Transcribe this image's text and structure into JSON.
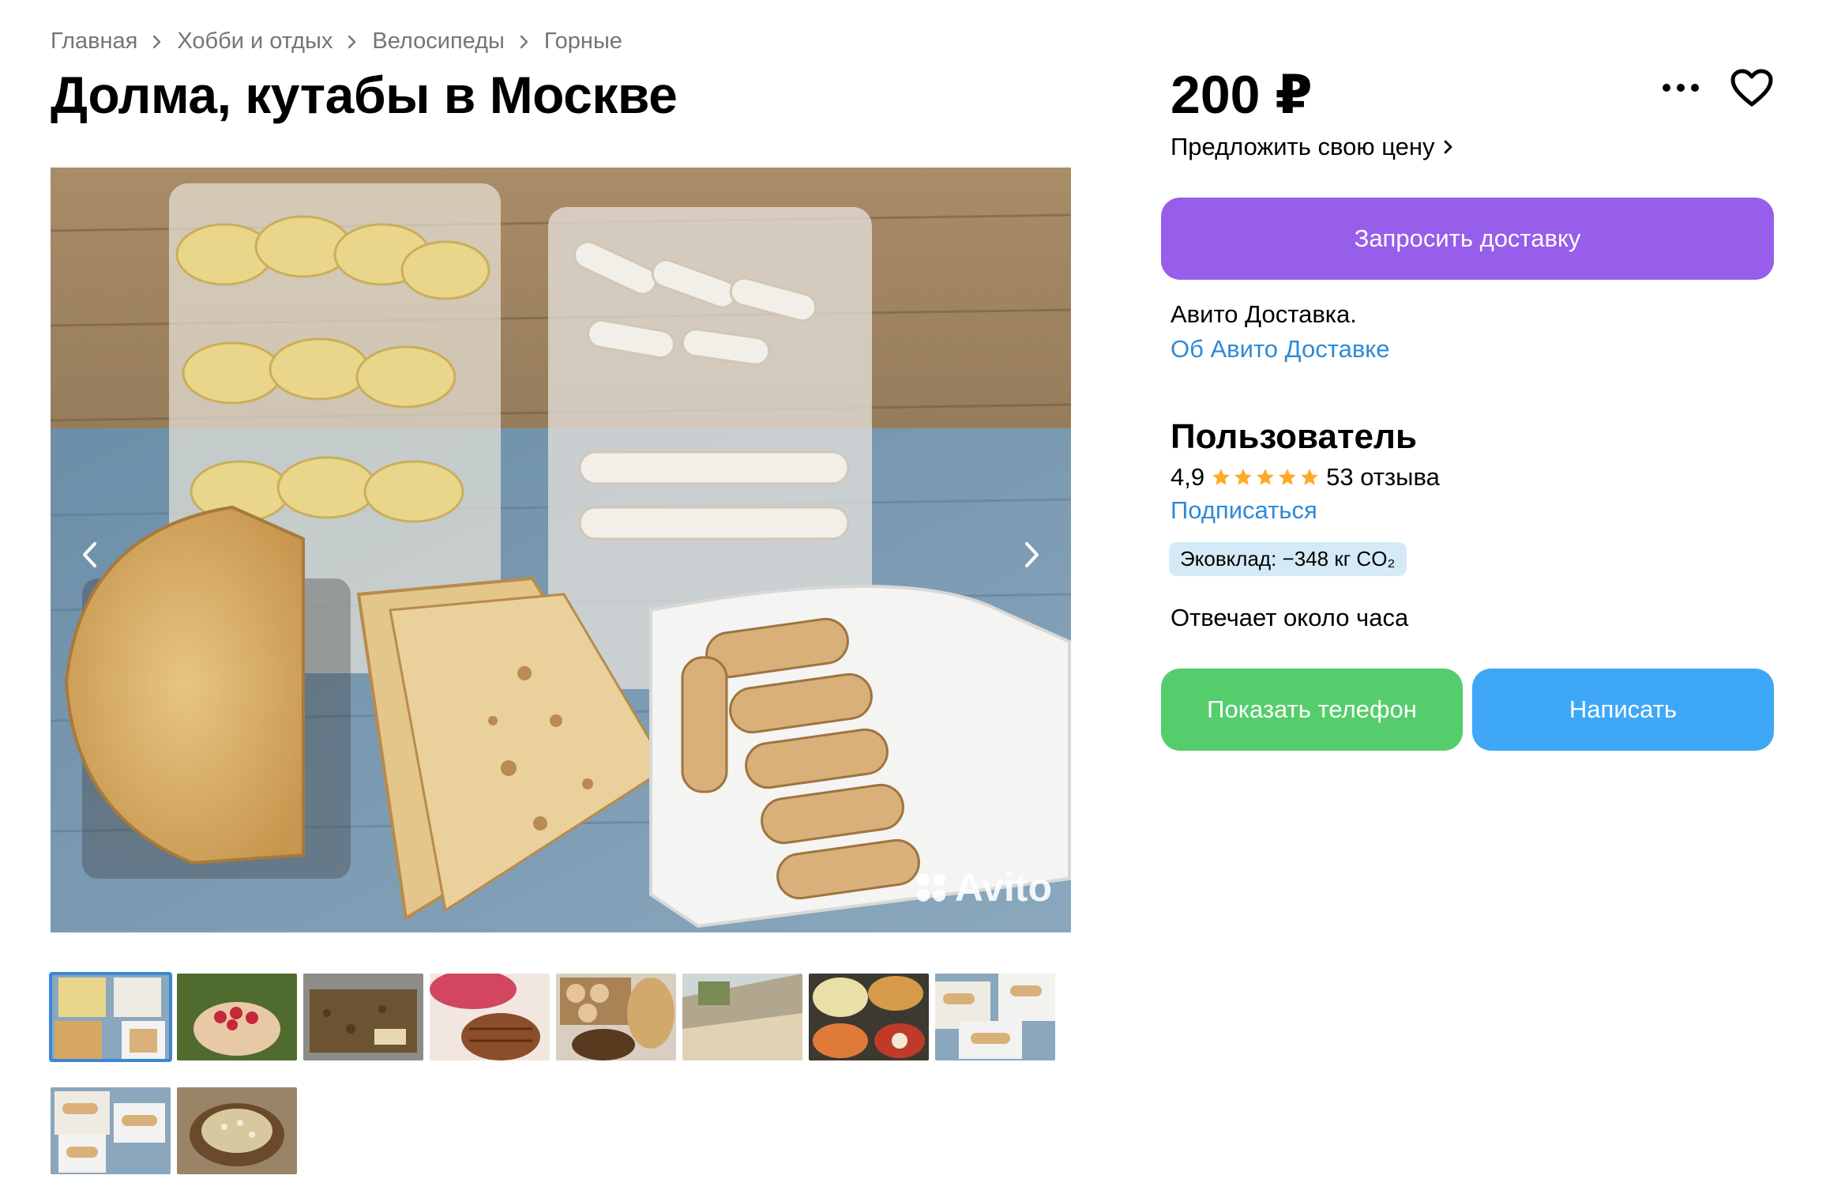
{
  "breadcrumbs": [
    "Главная",
    "Хобби и отдых",
    "Велосипеды",
    "Горные"
  ],
  "title": "Долма, кутабы в Москве",
  "gallery": {
    "watermark": "Avito",
    "prev_icon": "chevron-left-icon",
    "next_icon": "chevron-right-icon",
    "thumbnail_count": 10,
    "active_thumbnail": 1
  },
  "price": "200 ₽",
  "offer_price": "Предложить свою цену",
  "buttons": {
    "delivery": "Запросить доставку",
    "phone": "Показать телефон",
    "write": "Написать"
  },
  "delivery": {
    "text": "Авито Доставка.",
    "link": "Об Авито Доставке"
  },
  "seller": {
    "name": "Пользователь",
    "rating": "4,9",
    "stars": 5,
    "reviews": "53 отзыва",
    "subscribe": "Подписаться",
    "eco": "Эковклад: −348 кг CO₂",
    "response": "Отвечает около часа"
  },
  "icons": {
    "more": "more-dots-icon",
    "favorite": "heart-icon"
  },
  "colors": {
    "delivery_button": "#965eeb",
    "phone_button": "#55cd6c",
    "write_button": "#3fa8f6",
    "link": "#2f8ad6",
    "star": "#ffa929",
    "eco_badge": "#d4ebf7"
  }
}
